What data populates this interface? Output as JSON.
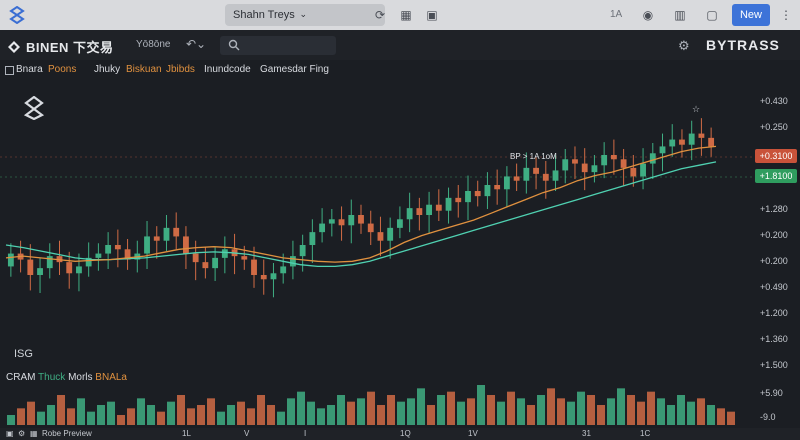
{
  "topbar": {
    "tab_title": "Shahn Treys",
    "lang": "1A",
    "new_label": "New",
    "icons": [
      "app-logo-icon",
      "chevron-down-icon",
      "refresh-icon",
      "grid-icon",
      "lock-icon",
      "toggle-icon",
      "layout-icon",
      "window-icon",
      "menu-icon"
    ]
  },
  "header": {
    "brand": "BINEN 下交易",
    "symbol": "Yō8ōne",
    "undo_glyph": "↶⌄",
    "search_value": "",
    "right_brand": "BYTRASS"
  },
  "indicators": [
    {
      "label": "Bnara",
      "color": "#d8dbe0"
    },
    {
      "label": "Poons",
      "color": "#e0913f"
    },
    {
      "label": "Jhuky",
      "color": "#d8dbe0"
    },
    {
      "label": "Biskuan",
      "color": "#e0913f"
    },
    {
      "label": "Jbibds",
      "color": "#e0913f"
    },
    {
      "label": "Inundcode",
      "color": "#d8dbe0"
    },
    {
      "label": "Gamesdar Fing",
      "color": "#d8dbe0"
    }
  ],
  "price_axis": {
    "labels": [
      "+0.430",
      "+0.250",
      "+1.280",
      "+0.200",
      "+0.200",
      "+0.490",
      "+1.200",
      "+1.360",
      "+1.500"
    ],
    "tag_red": "+0.3100",
    "tag_green": "+1.8100",
    "colors": {
      "up": "#3fae83",
      "down": "#d06b45",
      "tag_red": "#c9533a",
      "tag_green": "#2f9d5f"
    }
  },
  "annotation": "BP > 1A 1oM",
  "star_glyph": "☆",
  "pane_label": "ISG",
  "volume_legend": [
    {
      "label": "CRAM",
      "color": "#d8dbe0"
    },
    {
      "label": "Thuck",
      "color": "#3fae83"
    },
    {
      "label": "Morls",
      "color": "#d8dbe0"
    },
    {
      "label": "BNALa",
      "color": "#e0913f"
    }
  ],
  "volume_axis": {
    "top": "+5.90",
    "bottom": "-9.0"
  },
  "bottom_bar": {
    "preview": "Robe Preview",
    "time_labels": [
      "1L",
      "V",
      "I",
      "1Q",
      "1V",
      "31",
      "1C"
    ]
  },
  "chart_data": {
    "type": "candlestick",
    "series_candles": [
      [
        0.8,
        0.95
      ],
      [
        0.95,
        0.88
      ],
      [
        0.88,
        0.7
      ],
      [
        0.7,
        0.78
      ],
      [
        0.78,
        0.92
      ],
      [
        0.92,
        0.85
      ],
      [
        0.85,
        0.72
      ],
      [
        0.72,
        0.8
      ],
      [
        0.8,
        0.9
      ],
      [
        0.9,
        0.95
      ],
      [
        0.95,
        1.05
      ],
      [
        1.05,
        1.0
      ],
      [
        1.0,
        0.88
      ],
      [
        0.88,
        0.95
      ],
      [
        0.95,
        1.15
      ],
      [
        1.15,
        1.1
      ],
      [
        1.1,
        1.25
      ],
      [
        1.25,
        1.15
      ],
      [
        1.15,
        0.95
      ],
      [
        0.95,
        0.85
      ],
      [
        0.85,
        0.78
      ],
      [
        0.78,
        0.9
      ],
      [
        0.9,
        1.0
      ],
      [
        1.0,
        0.92
      ],
      [
        0.92,
        0.88
      ],
      [
        0.88,
        0.7
      ],
      [
        0.7,
        0.65
      ],
      [
        0.65,
        0.72
      ],
      [
        0.72,
        0.8
      ],
      [
        0.8,
        0.92
      ],
      [
        0.92,
        1.05
      ],
      [
        1.05,
        1.2
      ],
      [
        1.2,
        1.3
      ],
      [
        1.3,
        1.35
      ],
      [
        1.35,
        1.28
      ],
      [
        1.28,
        1.4
      ],
      [
        1.4,
        1.3
      ],
      [
        1.3,
        1.2
      ],
      [
        1.2,
        1.1
      ],
      [
        1.1,
        1.25
      ],
      [
        1.25,
        1.35
      ],
      [
        1.35,
        1.48
      ],
      [
        1.48,
        1.4
      ],
      [
        1.4,
        1.52
      ],
      [
        1.52,
        1.45
      ],
      [
        1.45,
        1.6
      ],
      [
        1.6,
        1.55
      ],
      [
        1.55,
        1.68
      ],
      [
        1.68,
        1.62
      ],
      [
        1.62,
        1.75
      ],
      [
        1.75,
        1.7
      ],
      [
        1.7,
        1.85
      ],
      [
        1.85,
        1.8
      ],
      [
        1.8,
        1.95
      ],
      [
        1.95,
        1.88
      ],
      [
        1.88,
        1.8
      ],
      [
        1.8,
        1.92
      ],
      [
        1.92,
        2.05
      ],
      [
        2.05,
        2.0
      ],
      [
        2.0,
        1.9
      ],
      [
        1.9,
        1.98
      ],
      [
        1.98,
        2.1
      ],
      [
        2.1,
        2.05
      ],
      [
        2.05,
        1.95
      ],
      [
        1.95,
        1.85
      ],
      [
        1.85,
        2.0
      ],
      [
        2.0,
        2.12
      ],
      [
        2.12,
        2.2
      ],
      [
        2.2,
        2.28
      ],
      [
        2.28,
        2.22
      ],
      [
        2.22,
        2.35
      ],
      [
        2.35,
        2.3
      ],
      [
        2.3,
        2.2
      ]
    ],
    "series_ma_fast": [
      0.9,
      0.92,
      0.9,
      0.88,
      0.86,
      0.87,
      0.88,
      0.9,
      0.92,
      0.96,
      1.0,
      1.02,
      1.03,
      1.02,
      0.98,
      0.94,
      0.9,
      0.88,
      0.86,
      0.85,
      0.86,
      0.9,
      0.98,
      1.08,
      1.16,
      1.22,
      1.28,
      1.34,
      1.42,
      1.5,
      1.58,
      1.66,
      1.72,
      1.8,
      1.86,
      1.9,
      1.96,
      2.02,
      2.08,
      2.14,
      2.18,
      2.2
    ],
    "series_ma_slow": [
      1.05,
      1.02,
      0.98,
      0.94,
      0.9,
      0.88,
      0.88,
      0.89,
      0.9,
      0.92,
      0.94,
      0.96,
      0.97,
      0.96,
      0.94,
      0.9,
      0.86,
      0.82,
      0.8,
      0.8,
      0.82,
      0.86,
      0.92,
      0.98,
      1.04,
      1.1,
      1.16,
      1.22,
      1.28,
      1.34,
      1.4,
      1.46,
      1.52,
      1.58,
      1.64,
      1.7,
      1.76,
      1.82,
      1.88,
      1.94,
      1.98,
      2.02
    ],
    "volume": [
      3,
      5,
      7,
      4,
      6,
      9,
      5,
      8,
      4,
      6,
      7,
      3,
      5,
      8,
      6,
      4,
      7,
      9,
      5,
      6,
      8,
      4,
      6,
      7,
      5,
      9,
      6,
      4,
      8,
      10,
      7,
      5,
      6,
      9,
      7,
      8,
      10,
      6,
      9,
      7,
      8,
      11,
      6,
      9,
      10,
      7,
      8,
      12,
      9,
      7,
      10,
      8,
      6,
      9,
      11,
      8,
      7,
      10,
      9,
      6,
      8,
      11,
      9,
      7,
      10,
      8,
      6,
      9,
      7,
      8,
      6,
      5,
      4
    ],
    "ylim": [
      0.0,
      2.8
    ]
  }
}
